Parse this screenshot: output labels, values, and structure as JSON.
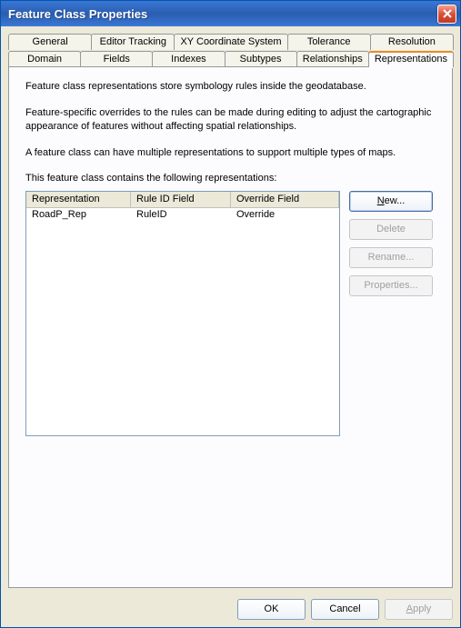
{
  "window": {
    "title": "Feature Class Properties"
  },
  "tabs": {
    "row1": [
      {
        "label": "General"
      },
      {
        "label": "Editor Tracking"
      },
      {
        "label": "XY Coordinate System"
      },
      {
        "label": "Tolerance"
      },
      {
        "label": "Resolution"
      }
    ],
    "row2": [
      {
        "label": "Domain"
      },
      {
        "label": "Fields"
      },
      {
        "label": "Indexes"
      },
      {
        "label": "Subtypes"
      },
      {
        "label": "Relationships"
      },
      {
        "label": "Representations",
        "active": true
      }
    ]
  },
  "body": {
    "p1": "Feature class representations store symbology rules inside the geodatabase.",
    "p2": "Feature-specific overrides to the rules can be made during editing to adjust the cartographic appearance of features without affecting spatial relationships.",
    "p3": "A feature class can have multiple representations to support multiple types of maps.",
    "p4": "This feature class contains the following representations:"
  },
  "list": {
    "columns": {
      "rep": "Representation",
      "rule": "Rule ID Field",
      "over": "Override Field"
    },
    "rows": [
      {
        "rep": "RoadP_Rep",
        "rule": "RuleID",
        "over": "Override"
      }
    ]
  },
  "sideButtons": {
    "new_prefix": "N",
    "new_suffix": "ew...",
    "delete": "Delete",
    "rename": "Rename...",
    "properties": "Properties..."
  },
  "bottomButtons": {
    "ok": "OK",
    "cancel": "Cancel",
    "apply_prefix": "A",
    "apply_suffix": "pply"
  }
}
